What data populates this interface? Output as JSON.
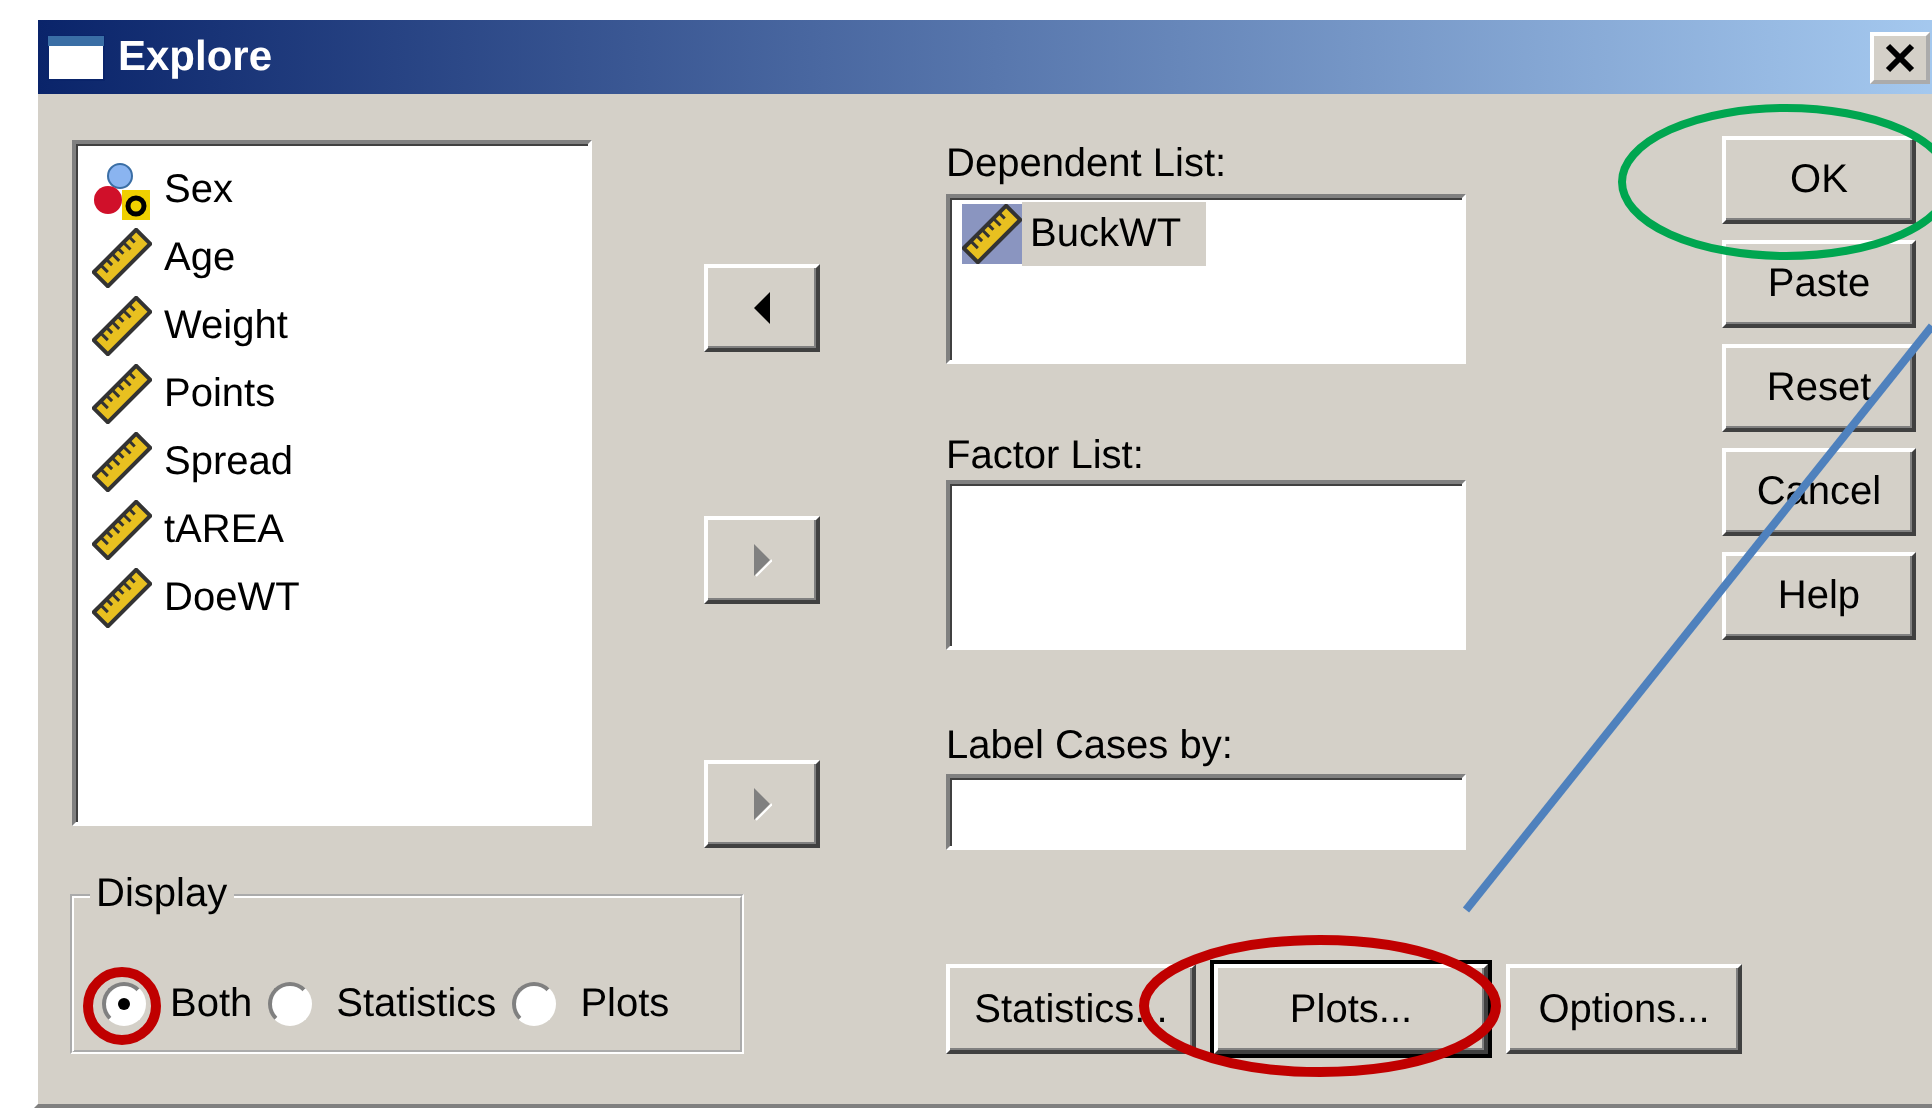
{
  "window": {
    "title": "Explore"
  },
  "variables": [
    {
      "label": "Sex",
      "kind": "nominal"
    },
    {
      "label": "Age",
      "kind": "scale"
    },
    {
      "label": "Weight",
      "kind": "scale"
    },
    {
      "label": "Points",
      "kind": "scale"
    },
    {
      "label": "Spread",
      "kind": "scale"
    },
    {
      "label": "tAREA",
      "kind": "scale"
    },
    {
      "label": "DoeWT",
      "kind": "scale"
    }
  ],
  "transfer_buttons": [
    {
      "kind": "left",
      "disabled": false
    },
    {
      "kind": "right",
      "disabled": true
    },
    {
      "kind": "right",
      "disabled": true
    }
  ],
  "dependent_list": {
    "label": "Dependent List:",
    "items": [
      {
        "label": "BuckWT",
        "kind": "scale",
        "selected": true
      }
    ]
  },
  "factor_list": {
    "label": "Factor List:"
  },
  "label_cases": {
    "label": "Label Cases by:"
  },
  "side_buttons": [
    "OK",
    "Paste",
    "Reset",
    "Cancel",
    "Help"
  ],
  "display": {
    "label": "Display",
    "options": [
      {
        "label": "Both",
        "selected": true
      },
      {
        "label": "Statistics",
        "selected": false
      },
      {
        "label": "Plots",
        "selected": false
      }
    ]
  },
  "bottom_buttons": [
    {
      "label": "Statistics...",
      "focused": false
    },
    {
      "label": "Plots...",
      "focused": true
    },
    {
      "label": "Options...",
      "focused": false
    }
  ]
}
